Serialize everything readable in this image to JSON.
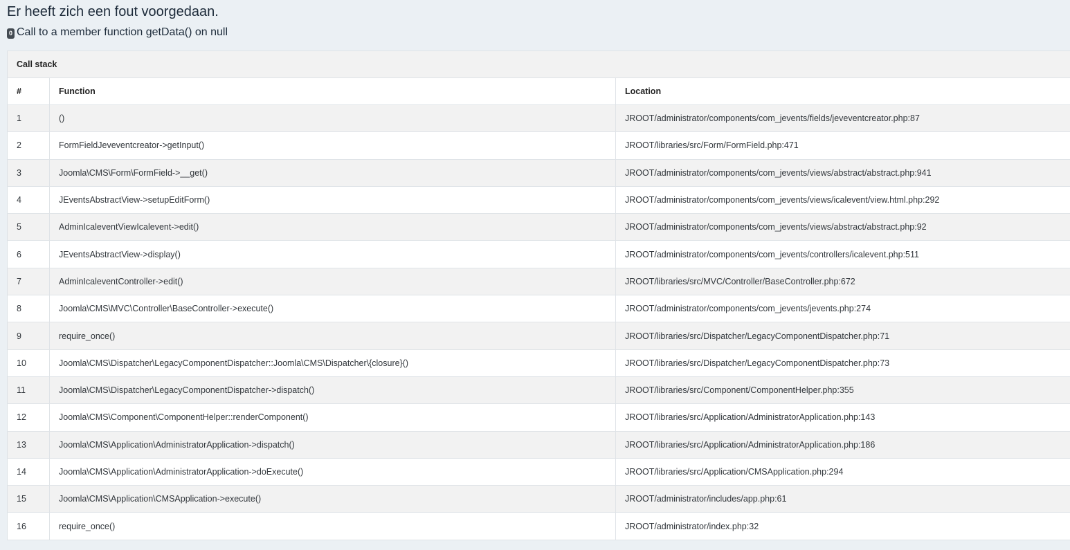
{
  "error": {
    "title": "Er heeft zich een fout voorgedaan.",
    "code": "0",
    "message": "Call to a member function getData() on null"
  },
  "callstack": {
    "caption": "Call stack",
    "headers": {
      "num": "#",
      "function": "Function",
      "location": "Location"
    },
    "rows": [
      {
        "num": "1",
        "function": "()",
        "location": "JROOT/administrator/components/com_jevents/fields/jeveventcreator.php:87"
      },
      {
        "num": "2",
        "function": "FormFieldJeveventcreator->getInput()",
        "location": "JROOT/libraries/src/Form/FormField.php:471"
      },
      {
        "num": "3",
        "function": "Joomla\\CMS\\Form\\FormField->__get()",
        "location": "JROOT/administrator/components/com_jevents/views/abstract/abstract.php:941"
      },
      {
        "num": "4",
        "function": "JEventsAbstractView->setupEditForm()",
        "location": "JROOT/administrator/components/com_jevents/views/icalevent/view.html.php:292"
      },
      {
        "num": "5",
        "function": "AdminIcaleventViewIcalevent->edit()",
        "location": "JROOT/administrator/components/com_jevents/views/abstract/abstract.php:92"
      },
      {
        "num": "6",
        "function": "JEventsAbstractView->display()",
        "location": "JROOT/administrator/components/com_jevents/controllers/icalevent.php:511"
      },
      {
        "num": "7",
        "function": "AdminIcaleventController->edit()",
        "location": "JROOT/libraries/src/MVC/Controller/BaseController.php:672"
      },
      {
        "num": "8",
        "function": "Joomla\\CMS\\MVC\\Controller\\BaseController->execute()",
        "location": "JROOT/administrator/components/com_jevents/jevents.php:274"
      },
      {
        "num": "9",
        "function": "require_once()",
        "location": "JROOT/libraries/src/Dispatcher/LegacyComponentDispatcher.php:71"
      },
      {
        "num": "10",
        "function": "Joomla\\CMS\\Dispatcher\\LegacyComponentDispatcher::Joomla\\CMS\\Dispatcher\\{closure}()",
        "location": "JROOT/libraries/src/Dispatcher/LegacyComponentDispatcher.php:73"
      },
      {
        "num": "11",
        "function": "Joomla\\CMS\\Dispatcher\\LegacyComponentDispatcher->dispatch()",
        "location": "JROOT/libraries/src/Component/ComponentHelper.php:355"
      },
      {
        "num": "12",
        "function": "Joomla\\CMS\\Component\\ComponentHelper::renderComponent()",
        "location": "JROOT/libraries/src/Application/AdministratorApplication.php:143"
      },
      {
        "num": "13",
        "function": "Joomla\\CMS\\Application\\AdministratorApplication->dispatch()",
        "location": "JROOT/libraries/src/Application/AdministratorApplication.php:186"
      },
      {
        "num": "14",
        "function": "Joomla\\CMS\\Application\\AdministratorApplication->doExecute()",
        "location": "JROOT/libraries/src/Application/CMSApplication.php:294"
      },
      {
        "num": "15",
        "function": "Joomla\\CMS\\Application\\CMSApplication->execute()",
        "location": "JROOT/administrator/includes/app.php:61"
      },
      {
        "num": "16",
        "function": "require_once()",
        "location": "JROOT/administrator/index.php:32"
      }
    ]
  }
}
